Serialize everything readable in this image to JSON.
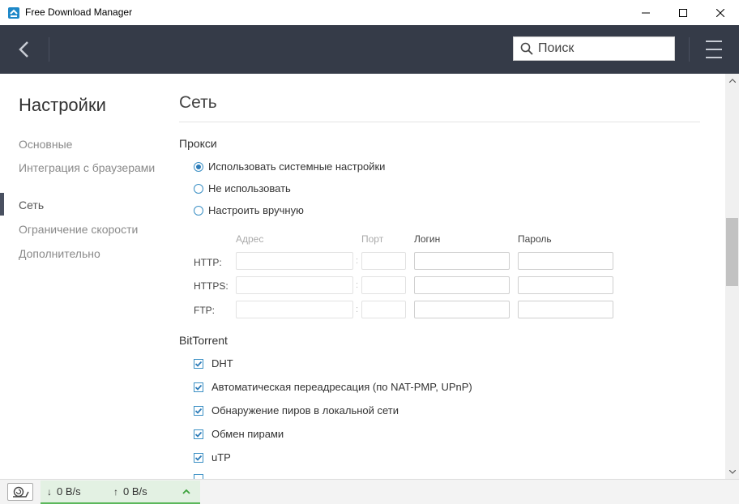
{
  "window": {
    "title": "Free Download Manager"
  },
  "header": {
    "search_placeholder": "Поиск"
  },
  "sidebar": {
    "title": "Настройки",
    "items": [
      {
        "label": "Основные"
      },
      {
        "label": "Интеграция с браузерами"
      },
      {
        "label": "Сеть"
      },
      {
        "label": "Ограничение скорости"
      },
      {
        "label": "Дополнительно"
      }
    ],
    "active": "Сеть"
  },
  "content": {
    "title": "Сеть",
    "proxy": {
      "label": "Прокси",
      "options": [
        {
          "label": "Использовать системные настройки",
          "selected": true
        },
        {
          "label": "Не использовать",
          "selected": false
        },
        {
          "label": "Настроить вручную",
          "selected": false
        }
      ],
      "columns": {
        "address": "Адрес",
        "port": "Порт",
        "login": "Логин",
        "password": "Пароль"
      },
      "rows": [
        {
          "label": "HTTP:"
        },
        {
          "label": "HTTPS:"
        },
        {
          "label": "FTP:"
        }
      ]
    },
    "bittorrent": {
      "label": "BitTorrent",
      "options": [
        {
          "label": "DHT",
          "checked": true
        },
        {
          "label": "Автоматическая переадресация (по NAT-PMP, UPnP)",
          "checked": true
        },
        {
          "label": "Обнаружение пиров в локальной сети",
          "checked": true
        },
        {
          "label": "Обмен пирами",
          "checked": true
        },
        {
          "label": "uTP",
          "checked": true
        }
      ]
    }
  },
  "statusbar": {
    "download_speed": "0 B/s",
    "upload_speed": "0 B/s"
  },
  "colors": {
    "header_bg": "#353b48",
    "accent_blue": "#2d7cb8",
    "speed_panel_bg": "#e3f1e3",
    "speed_panel_border": "#5cb85c"
  }
}
